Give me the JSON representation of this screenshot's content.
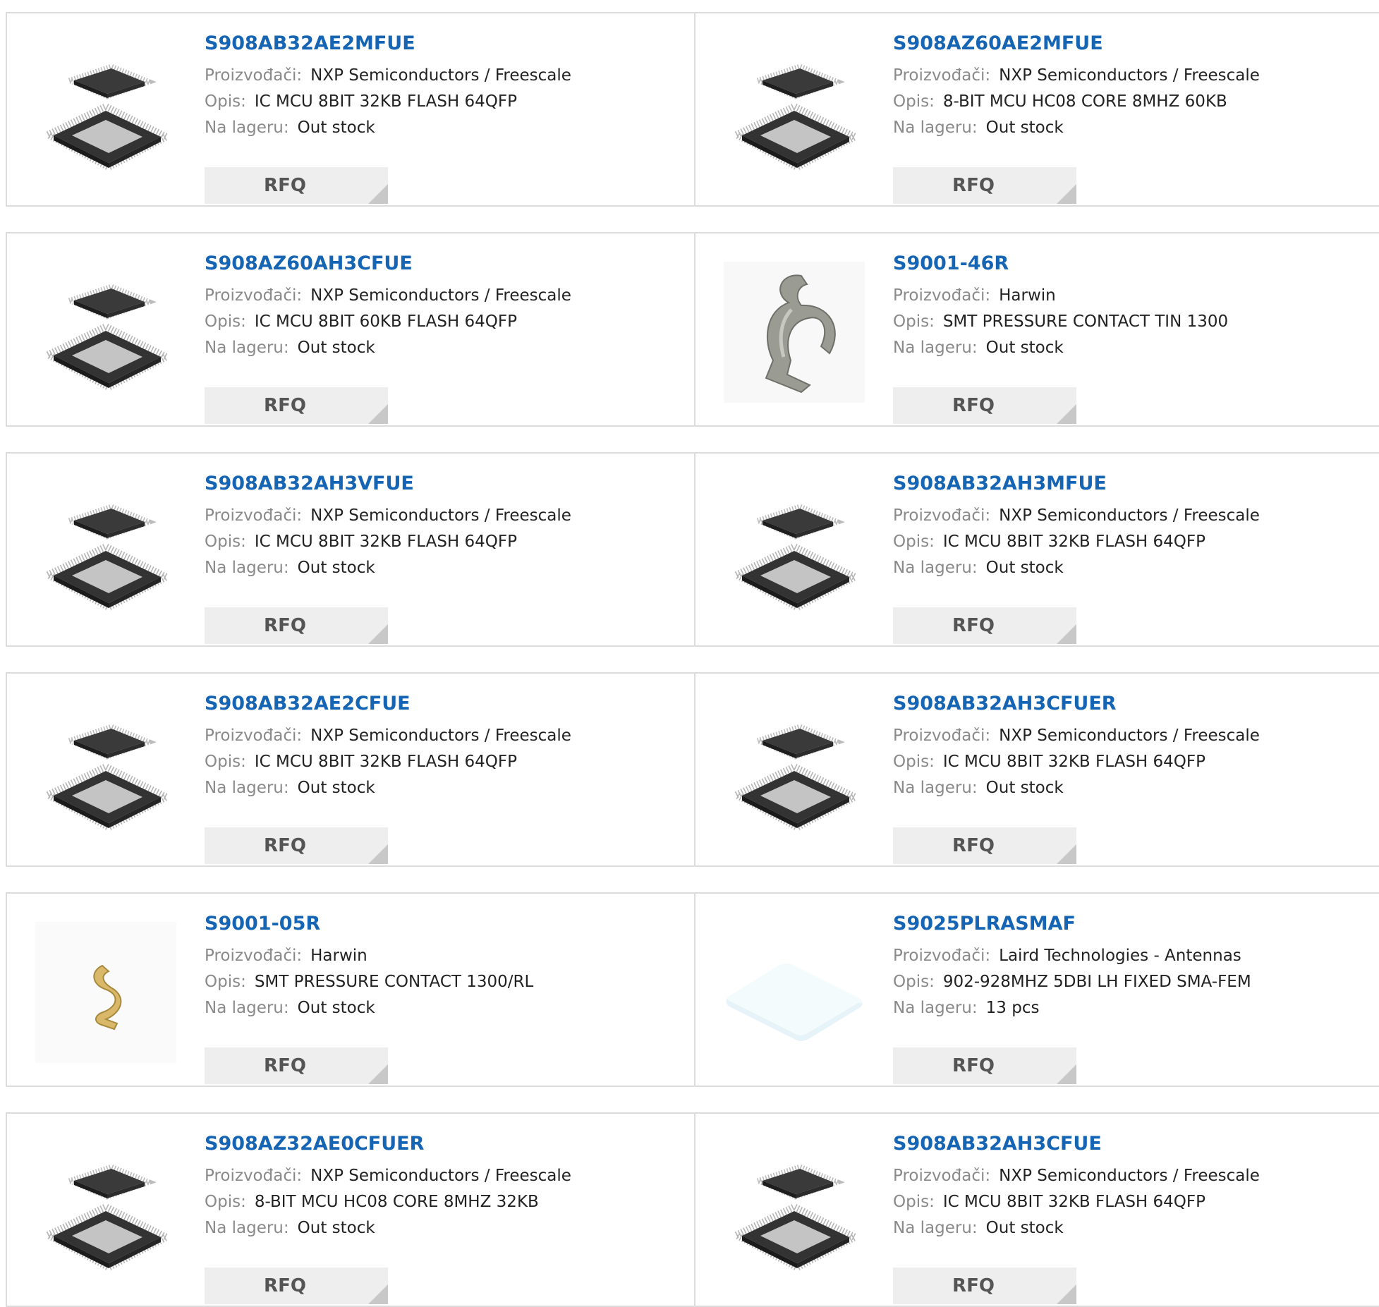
{
  "labels": {
    "manufacturer": "Proizvođači:",
    "description": "Opis:",
    "stock": "Na lageru:",
    "rfq": "RFQ"
  },
  "colors": {
    "part_link": "#1565b4",
    "label_gray": "#8a8a8a",
    "rfq_bg": "#eeeeee",
    "border": "#dcdcdc"
  },
  "products": [
    {
      "part": "S908AB32AE2MFUE",
      "manufacturer": "NXP Semiconductors / Freescale",
      "description": "IC MCU 8BIT 32KB FLASH 64QFP",
      "stock": "Out stock",
      "image": "qfp-chip-icon"
    },
    {
      "part": "S908AZ60AE2MFUE",
      "manufacturer": "NXP Semiconductors / Freescale",
      "description": "8-BIT MCU HC08 CORE 8MHZ 60KB",
      "stock": "Out stock",
      "image": "qfp-chip-icon"
    },
    {
      "part": "S908AZ60AH3CFUE",
      "manufacturer": "NXP Semiconductors / Freescale",
      "description": "IC MCU 8BIT 60KB FLASH 64QFP",
      "stock": "Out stock",
      "image": "qfp-chip-icon"
    },
    {
      "part": "S9001-46R",
      "manufacturer": "Harwin",
      "description": "SMT PRESSURE CONTACT TIN 1300",
      "stock": "Out stock",
      "image": "tin-contact-clip-icon"
    },
    {
      "part": "S908AB32AH3VFUE",
      "manufacturer": "NXP Semiconductors / Freescale",
      "description": "IC MCU 8BIT 32KB FLASH 64QFP",
      "stock": "Out stock",
      "image": "qfp-chip-icon"
    },
    {
      "part": "S908AB32AH3MFUE",
      "manufacturer": "NXP Semiconductors / Freescale",
      "description": "IC MCU 8BIT 32KB FLASH 64QFP",
      "stock": "Out stock",
      "image": "qfp-chip-icon"
    },
    {
      "part": "S908AB32AE2CFUE",
      "manufacturer": "NXP Semiconductors / Freescale",
      "description": "IC MCU 8BIT 32KB FLASH 64QFP",
      "stock": "Out stock",
      "image": "qfp-chip-icon"
    },
    {
      "part": "S908AB32AH3CFUER",
      "manufacturer": "NXP Semiconductors / Freescale",
      "description": "IC MCU 8BIT 32KB FLASH 64QFP",
      "stock": "Out stock",
      "image": "qfp-chip-icon"
    },
    {
      "part": "S9001-05R",
      "manufacturer": "Harwin",
      "description": "SMT PRESSURE CONTACT 1300/RL",
      "stock": "Out stock",
      "image": "gold-contact-clip-icon"
    },
    {
      "part": "S9025PLRASMAF",
      "manufacturer": "Laird Technologies - Antennas",
      "description": "902-928MHZ 5DBI LH FIXED SMA-FEM",
      "stock": "13 pcs",
      "image": "antenna-panel-icon"
    },
    {
      "part": "S908AZ32AE0CFUER",
      "manufacturer": "NXP Semiconductors / Freescale",
      "description": "8-BIT MCU HC08 CORE 8MHZ 32KB",
      "stock": "Out stock",
      "image": "qfp-chip-icon"
    },
    {
      "part": "S908AB32AH3CFUE",
      "manufacturer": "NXP Semiconductors / Freescale",
      "description": "IC MCU 8BIT 32KB FLASH 64QFP",
      "stock": "Out stock",
      "image": "qfp-chip-icon"
    }
  ]
}
